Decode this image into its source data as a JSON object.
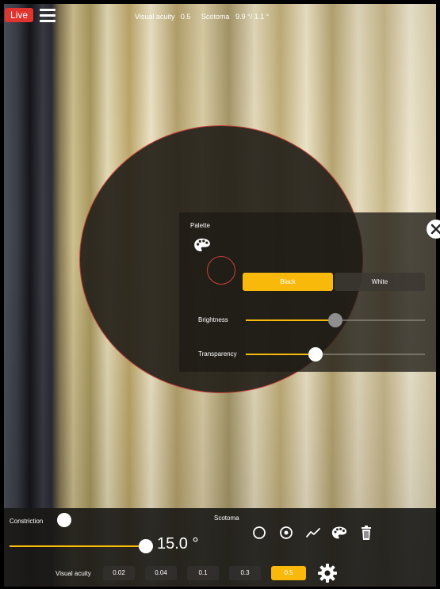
{
  "live_badge": "Live",
  "top_status": {
    "acuity_label": "Visual acuity",
    "acuity_value": "0.5",
    "scotoma_label": "Scotoma",
    "scotoma_value": "9.9 °/ 1.1 °"
  },
  "palette": {
    "title": "Palette",
    "options": [
      "Black",
      "White"
    ],
    "selected": "Black",
    "brightness": {
      "label": "Brightness",
      "value": 0.5
    },
    "transparency": {
      "label": "Transparency",
      "value": 0.39
    }
  },
  "bottom": {
    "constriction_label": "Constriction",
    "scotoma_label": "Scotoma",
    "degree_value": "15.0 °",
    "degree_slider": 0.78,
    "acuity_label": "Visual acuity",
    "acuity_options": [
      "0.02",
      "0.04",
      "0.1",
      "0.3",
      "0.5"
    ],
    "acuity_selected": "0.5"
  },
  "colors": {
    "accent": "#f8b90a",
    "live": "#e0342f",
    "circle_border": "#c9423a"
  },
  "icons": [
    "menu-icon",
    "palette-icon",
    "close-icon",
    "circle-icon",
    "target-icon",
    "trend-icon",
    "palette-icon",
    "trash-icon",
    "gear-icon"
  ]
}
